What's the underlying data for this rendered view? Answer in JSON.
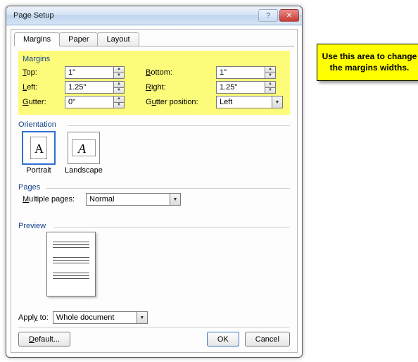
{
  "window": {
    "title": "Page Setup"
  },
  "tabs": {
    "margins": "Margins",
    "paper": "Paper",
    "layout": "Layout"
  },
  "margins": {
    "section_label": "Margins",
    "top_label": "Top:",
    "top_value": "1\"",
    "bottom_label": "Bottom:",
    "bottom_value": "1\"",
    "left_label": "Left:",
    "left_value": "1.25\"",
    "right_label": "Right:",
    "right_value": "1.25\"",
    "gutter_label": "Gutter:",
    "gutter_value": "0\"",
    "gutter_pos_label": "Gutter position:",
    "gutter_pos_value": "Left"
  },
  "orientation": {
    "section_label": "Orientation",
    "portrait": "Portrait",
    "landscape": "Landscape"
  },
  "pages": {
    "section_label": "Pages",
    "multiple_label": "Multiple pages:",
    "multiple_value": "Normal"
  },
  "preview": {
    "section_label": "Preview"
  },
  "apply": {
    "label": "Apply to:",
    "value": "Whole document"
  },
  "buttons": {
    "default": "Default...",
    "ok": "OK",
    "cancel": "Cancel"
  },
  "note": {
    "text": "Use this area to change the margins widths."
  }
}
